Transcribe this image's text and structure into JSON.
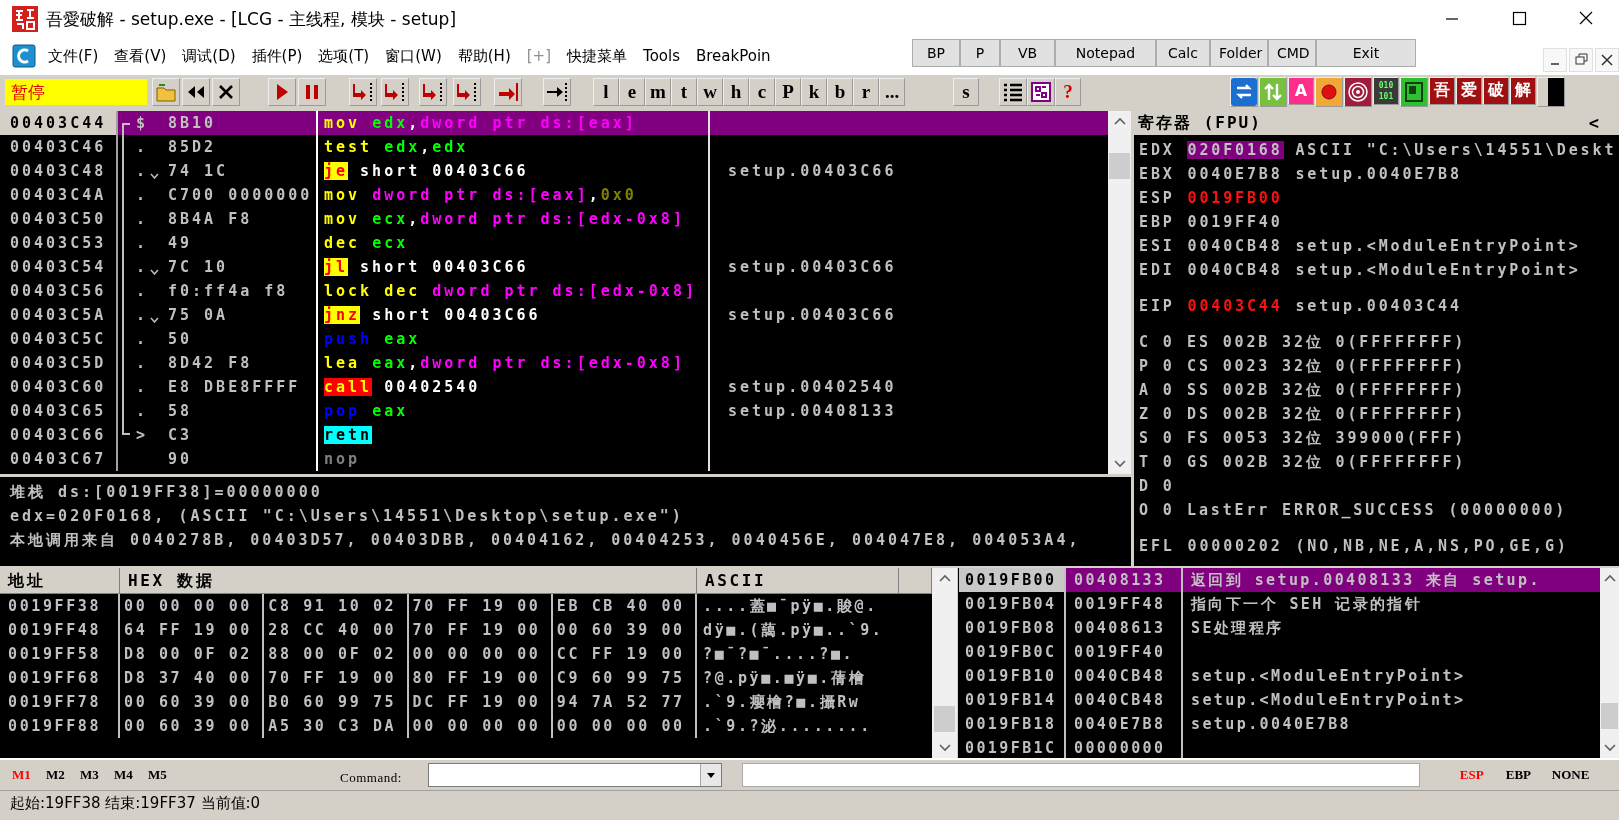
{
  "window": {
    "title": "吾愛破解 - setup.exe - [LCG -  主线程, 模块 - setup]"
  },
  "menu": [
    {
      "label": "文件(F)",
      "disabled": false
    },
    {
      "label": "查看(V)",
      "disabled": false
    },
    {
      "label": "调试(D)",
      "disabled": false
    },
    {
      "label": "插件(P)",
      "disabled": false
    },
    {
      "label": "选项(T)",
      "disabled": false
    },
    {
      "label": "窗口(W)",
      "disabled": false
    },
    {
      "label": "帮助(H)",
      "disabled": false
    },
    {
      "label": "[+]",
      "disabled": true
    },
    {
      "label": "快捷菜单",
      "disabled": false
    },
    {
      "label": "Tools",
      "disabled": false
    },
    {
      "label": "BreakPoin",
      "disabled": false
    }
  ],
  "quick_buttons": [
    "BP",
    "P",
    "VB",
    "Notepad",
    "Calc",
    "Folder",
    "CMD",
    "Exit"
  ],
  "toolbar": {
    "status": "暂停",
    "letters": [
      "l",
      "e",
      "m",
      "t",
      "w",
      "h",
      "c",
      "P",
      "k",
      "b",
      "r",
      "..."
    ],
    "extra_letter": "s",
    "help": "?",
    "right_buttons": [
      {
        "kind": "refresh"
      },
      {
        "kind": "updown"
      },
      {
        "kind": "letter",
        "label": "A"
      },
      {
        "kind": "record"
      },
      {
        "kind": "target"
      },
      {
        "kind": "binary",
        "lines": [
          "010",
          "101"
        ]
      },
      {
        "kind": "window"
      },
      {
        "kind": "char",
        "label": "吾"
      },
      {
        "kind": "char",
        "label": "爱"
      },
      {
        "kind": "char",
        "label": "破"
      },
      {
        "kind": "char",
        "label": "解"
      },
      {
        "kind": "bar"
      }
    ]
  },
  "disassembly": [
    {
      "address": "00403C44",
      "marker": "$",
      "bracket": {
        "kind": "start"
      },
      "jump": false,
      "bytes": "8B10",
      "mnemonic": "mov",
      "kind": "plain",
      "operands": [
        {
          "text": "edx",
          "kind": "reg"
        },
        {
          "text": ",",
          "kind": "punct"
        },
        {
          "text": "dword ptr ds:[eax]",
          "kind": "mem"
        }
      ],
      "selected": true
    },
    {
      "address": "00403C46",
      "marker": ".",
      "bracket": {
        "kind": "mid"
      },
      "jump": false,
      "bytes": "85D2",
      "mnemonic": "test",
      "kind": "plain",
      "operands": [
        {
          "text": "edx",
          "kind": "reg"
        },
        {
          "text": ",",
          "kind": "punct"
        },
        {
          "text": "edx",
          "kind": "reg"
        }
      ],
      "selected": false
    },
    {
      "address": "00403C48",
      "marker": ".",
      "bracket": {
        "kind": "mid"
      },
      "jump": true,
      "bytes": "74 1C",
      "mnemonic": "je",
      "kind": "jump",
      "operands": [
        {
          "text": "short 00403C66",
          "kind": "addr"
        }
      ],
      "comment": "setup.00403C66",
      "selected": false
    },
    {
      "address": "00403C4A",
      "marker": ".",
      "bracket": {
        "kind": "mid"
      },
      "jump": false,
      "bytes": "C700 0000000",
      "mnemonic": "mov",
      "kind": "plain",
      "operands": [
        {
          "text": "dword ptr ds:[eax]",
          "kind": "mem"
        },
        {
          "text": ",",
          "kind": "punct"
        },
        {
          "text": "0x0",
          "kind": "const"
        }
      ],
      "selected": false
    },
    {
      "address": "00403C50",
      "marker": ".",
      "bracket": {
        "kind": "mid"
      },
      "jump": false,
      "bytes": "8B4A F8",
      "mnemonic": "mov",
      "kind": "plain",
      "operands": [
        {
          "text": "ecx",
          "kind": "reg"
        },
        {
          "text": ",",
          "kind": "punct"
        },
        {
          "text": "dword ptr ds:[edx-0x8]",
          "kind": "mem"
        }
      ],
      "selected": false
    },
    {
      "address": "00403C53",
      "marker": ".",
      "bracket": {
        "kind": "mid"
      },
      "jump": false,
      "bytes": "49",
      "mnemonic": "dec",
      "kind": "plain",
      "operands": [
        {
          "text": "ecx",
          "kind": "reg"
        }
      ],
      "selected": false
    },
    {
      "address": "00403C54",
      "marker": ".",
      "bracket": {
        "kind": "mid"
      },
      "jump": true,
      "bytes": "7C 10",
      "mnemonic": "jl",
      "kind": "jump",
      "operands": [
        {
          "text": "short 00403C66",
          "kind": "addr"
        }
      ],
      "comment": "setup.00403C66",
      "selected": false
    },
    {
      "address": "00403C56",
      "marker": ".",
      "bracket": {
        "kind": "mid"
      },
      "jump": false,
      "bytes": "f0:ff4a f8",
      "mnemonic": "lock dec",
      "kind": "plain",
      "operands": [
        {
          "text": "dword ptr ds:[edx-0x8]",
          "kind": "mem"
        }
      ],
      "selected": false
    },
    {
      "address": "00403C5A",
      "marker": ".",
      "bracket": {
        "kind": "mid"
      },
      "jump": true,
      "bytes": "75 0A",
      "mnemonic": "jnz",
      "kind": "jump",
      "operands": [
        {
          "text": "short 00403C66",
          "kind": "addr"
        }
      ],
      "comment": "setup.00403C66",
      "selected": false
    },
    {
      "address": "00403C5C",
      "marker": ".",
      "bracket": {
        "kind": "mid"
      },
      "jump": false,
      "bytes": "50",
      "mnemonic": "push",
      "kind": "stack",
      "operands": [
        {
          "text": "eax",
          "kind": "reg"
        }
      ],
      "selected": false
    },
    {
      "address": "00403C5D",
      "marker": ".",
      "bracket": {
        "kind": "mid"
      },
      "jump": false,
      "bytes": "8D42 F8",
      "mnemonic": "lea",
      "kind": "plain",
      "operands": [
        {
          "text": "eax",
          "kind": "reg"
        },
        {
          "text": ",",
          "kind": "punct"
        },
        {
          "text": "dword ptr ds:[edx-0x8]",
          "kind": "mem"
        }
      ],
      "selected": false
    },
    {
      "address": "00403C60",
      "marker": ".",
      "bracket": {
        "kind": "mid"
      },
      "jump": false,
      "bytes": "E8 DBE8FFFF",
      "mnemonic": "call",
      "kind": "call",
      "operands": [
        {
          "text": "00402540",
          "kind": "addr"
        }
      ],
      "comment": "setup.00402540",
      "selected": false
    },
    {
      "address": "00403C65",
      "marker": ".",
      "bracket": {
        "kind": "mid"
      },
      "jump": false,
      "bytes": "58",
      "mnemonic": "pop",
      "kind": "stack",
      "operands": [
        {
          "text": "eax",
          "kind": "reg"
        }
      ],
      "comment": "setup.00408133",
      "selected": false
    },
    {
      "address": "00403C66",
      "marker": ">",
      "bracket": {
        "kind": "end"
      },
      "jump": false,
      "bytes": "C3",
      "mnemonic": "retn",
      "kind": "ret",
      "selected": false
    },
    {
      "address": "00403C67",
      "jump": false,
      "bytes": "90",
      "mnemonic": "nop",
      "kind": "nop",
      "selected": false
    }
  ],
  "info": [
    "堆栈 ds:[0019FF38]=00000000",
    "edx=020F0168, (ASCII \"C:\\Users\\14551\\Desktop\\setup.exe\")",
    "本地调用来自 0040278B, 00403D57, 00403DBB, 00404162, 00404253, 0040456E, 004047E8, 004053A4,"
  ],
  "registers": {
    "title": "寄存器 (FPU)",
    "collapse": "<",
    "groups": [
      {
        "rows": [
          {
            "kind": "reg",
            "name": "EDX",
            "value": "020F0168",
            "comment": "ASCII \"C:\\Users\\14551\\Deskt",
            "changed": false,
            "selected": true
          },
          {
            "kind": "reg",
            "name": "EBX",
            "value": "0040E7B8",
            "comment": "setup.0040E7B8",
            "changed": false,
            "selected": false
          },
          {
            "kind": "reg",
            "name": "ESP",
            "value": "0019FB00",
            "changed": true,
            "selected": false
          },
          {
            "kind": "reg",
            "name": "EBP",
            "value": "0019FF40",
            "changed": false,
            "selected": false
          },
          {
            "kind": "reg",
            "name": "ESI",
            "value": "0040CB48",
            "comment": "setup.<ModuleEntryPoint>",
            "changed": false,
            "selected": false
          },
          {
            "kind": "reg",
            "name": "EDI",
            "value": "0040CB48",
            "comment": "setup.<ModuleEntryPoint>",
            "changed": false,
            "selected": false
          }
        ]
      },
      {
        "rows": [
          {
            "kind": "reg",
            "name": "EIP",
            "value": "00403C44",
            "comment": "setup.00403C44",
            "changed": true,
            "selected": false
          }
        ]
      },
      {
        "rows": [
          {
            "kind": "flag",
            "flag": "C",
            "value": "0",
            "segment": "ES 002B 32位 0(FFFFFFFF)"
          },
          {
            "kind": "flag",
            "flag": "P",
            "value": "0",
            "segment": "CS 0023 32位 0(FFFFFFFF)"
          },
          {
            "kind": "flag",
            "flag": "A",
            "value": "0",
            "segment": "SS 002B 32位 0(FFFFFFFF)"
          },
          {
            "kind": "flag",
            "flag": "Z",
            "value": "0",
            "segment": "DS 002B 32位 0(FFFFFFFF)"
          },
          {
            "kind": "flag",
            "flag": "S",
            "value": "0",
            "segment": "FS 0053 32位 399000(FFF)"
          },
          {
            "kind": "flag",
            "flag": "T",
            "value": "0",
            "segment": "GS 002B 32位 0(FFFFFFFF)"
          },
          {
            "kind": "flag",
            "flag": "D",
            "value": "0"
          },
          {
            "kind": "flag",
            "flag": "O",
            "value": "0",
            "segment": "LastErr ERROR_SUCCESS (00000000)"
          }
        ]
      },
      {
        "rows": [
          {
            "kind": "reg",
            "name": "EFL",
            "value": "00000202",
            "comment": "(NO,NB,NE,A,NS,PO,GE,G)",
            "changed": false,
            "selected": false
          }
        ]
      }
    ]
  },
  "dump": {
    "columns": [
      "地址",
      "HEX 数据",
      "ASCII"
    ],
    "rows": [
      {
        "address": "0019FF38",
        "hex": [
          "00 00 00 00",
          "C8 91 10 02",
          "70 FF 19 00",
          "EB CB 40 00"
        ],
        "ascii": "....蓋■¯pÿ■.賐@."
      },
      {
        "address": "0019FF48",
        "hex": [
          "64 FF 19 00",
          "28 CC 40 00",
          "70 FF 19 00",
          "00 60 39 00"
        ],
        "ascii": "dÿ■.(藹.pÿ■..`9."
      },
      {
        "address": "0019FF58",
        "hex": [
          "D8 00 0F 02",
          "88 00 0F 02",
          "00 00 00 00",
          "CC FF 19 00"
        ],
        "ascii": "?■¯?■¯....?■."
      },
      {
        "address": "0019FF68",
        "hex": [
          "D8 37 40 00",
          "70 FF 19 00",
          "80 FF 19 00",
          "C9 60 99 75"
        ],
        "ascii": "?@.pÿ■.■ÿ■.蒨檜"
      },
      {
        "address": "0019FF78",
        "hex": [
          "00 60 39 00",
          "B0 60 99 75",
          "DC FF 19 00",
          "94 7A 52 77"
        ],
        "ascii": ".`9.癭檜?■.攝Rw"
      },
      {
        "address": "0019FF88",
        "hex": [
          "00 60 39 00",
          "A5 30 C3 DA",
          "00 00 00 00",
          "00 00 00 00"
        ],
        "ascii": ".`9.?泌........"
      }
    ]
  },
  "stack": [
    {
      "address": "0019FB00",
      "value": "00408133",
      "comment": "返回到 setup.00408133 来自 setup.",
      "selected": true
    },
    {
      "address": "0019FB04",
      "value": "0019FF48",
      "comment": "指向下一个 SEH 记录的指针",
      "selected": false
    },
    {
      "address": "0019FB08",
      "value": "00408613",
      "comment": "SE处理程序",
      "selected": false
    },
    {
      "address": "0019FB0C",
      "value": "0019FF40",
      "selected": false
    },
    {
      "address": "0019FB10",
      "value": "0040CB48",
      "comment": "setup.<ModuleEntryPoint>",
      "selected": false
    },
    {
      "address": "0019FB14",
      "value": "0040CB48",
      "comment": "setup.<ModuleEntryPoint>",
      "selected": false
    },
    {
      "address": "0019FB18",
      "value": "0040E7B8",
      "comment": "setup.0040E7B8",
      "selected": false
    },
    {
      "address": "0019FB1C",
      "value": "00000000",
      "selected": false
    }
  ],
  "command_bar": {
    "memory_tabs": [
      {
        "label": "M1",
        "selected": true
      },
      {
        "label": "M2",
        "selected": false
      },
      {
        "label": "M3",
        "selected": false
      },
      {
        "label": "M4",
        "selected": false
      },
      {
        "label": "M5",
        "selected": false
      }
    ],
    "command_label": "Command:",
    "stack_modes": [
      {
        "label": "ESP",
        "selected": true
      },
      {
        "label": "EBP",
        "selected": false
      },
      {
        "label": "NONE",
        "selected": false
      }
    ]
  },
  "status_bar": "起始:19FF38 结束:19FF37 当前值:0"
}
